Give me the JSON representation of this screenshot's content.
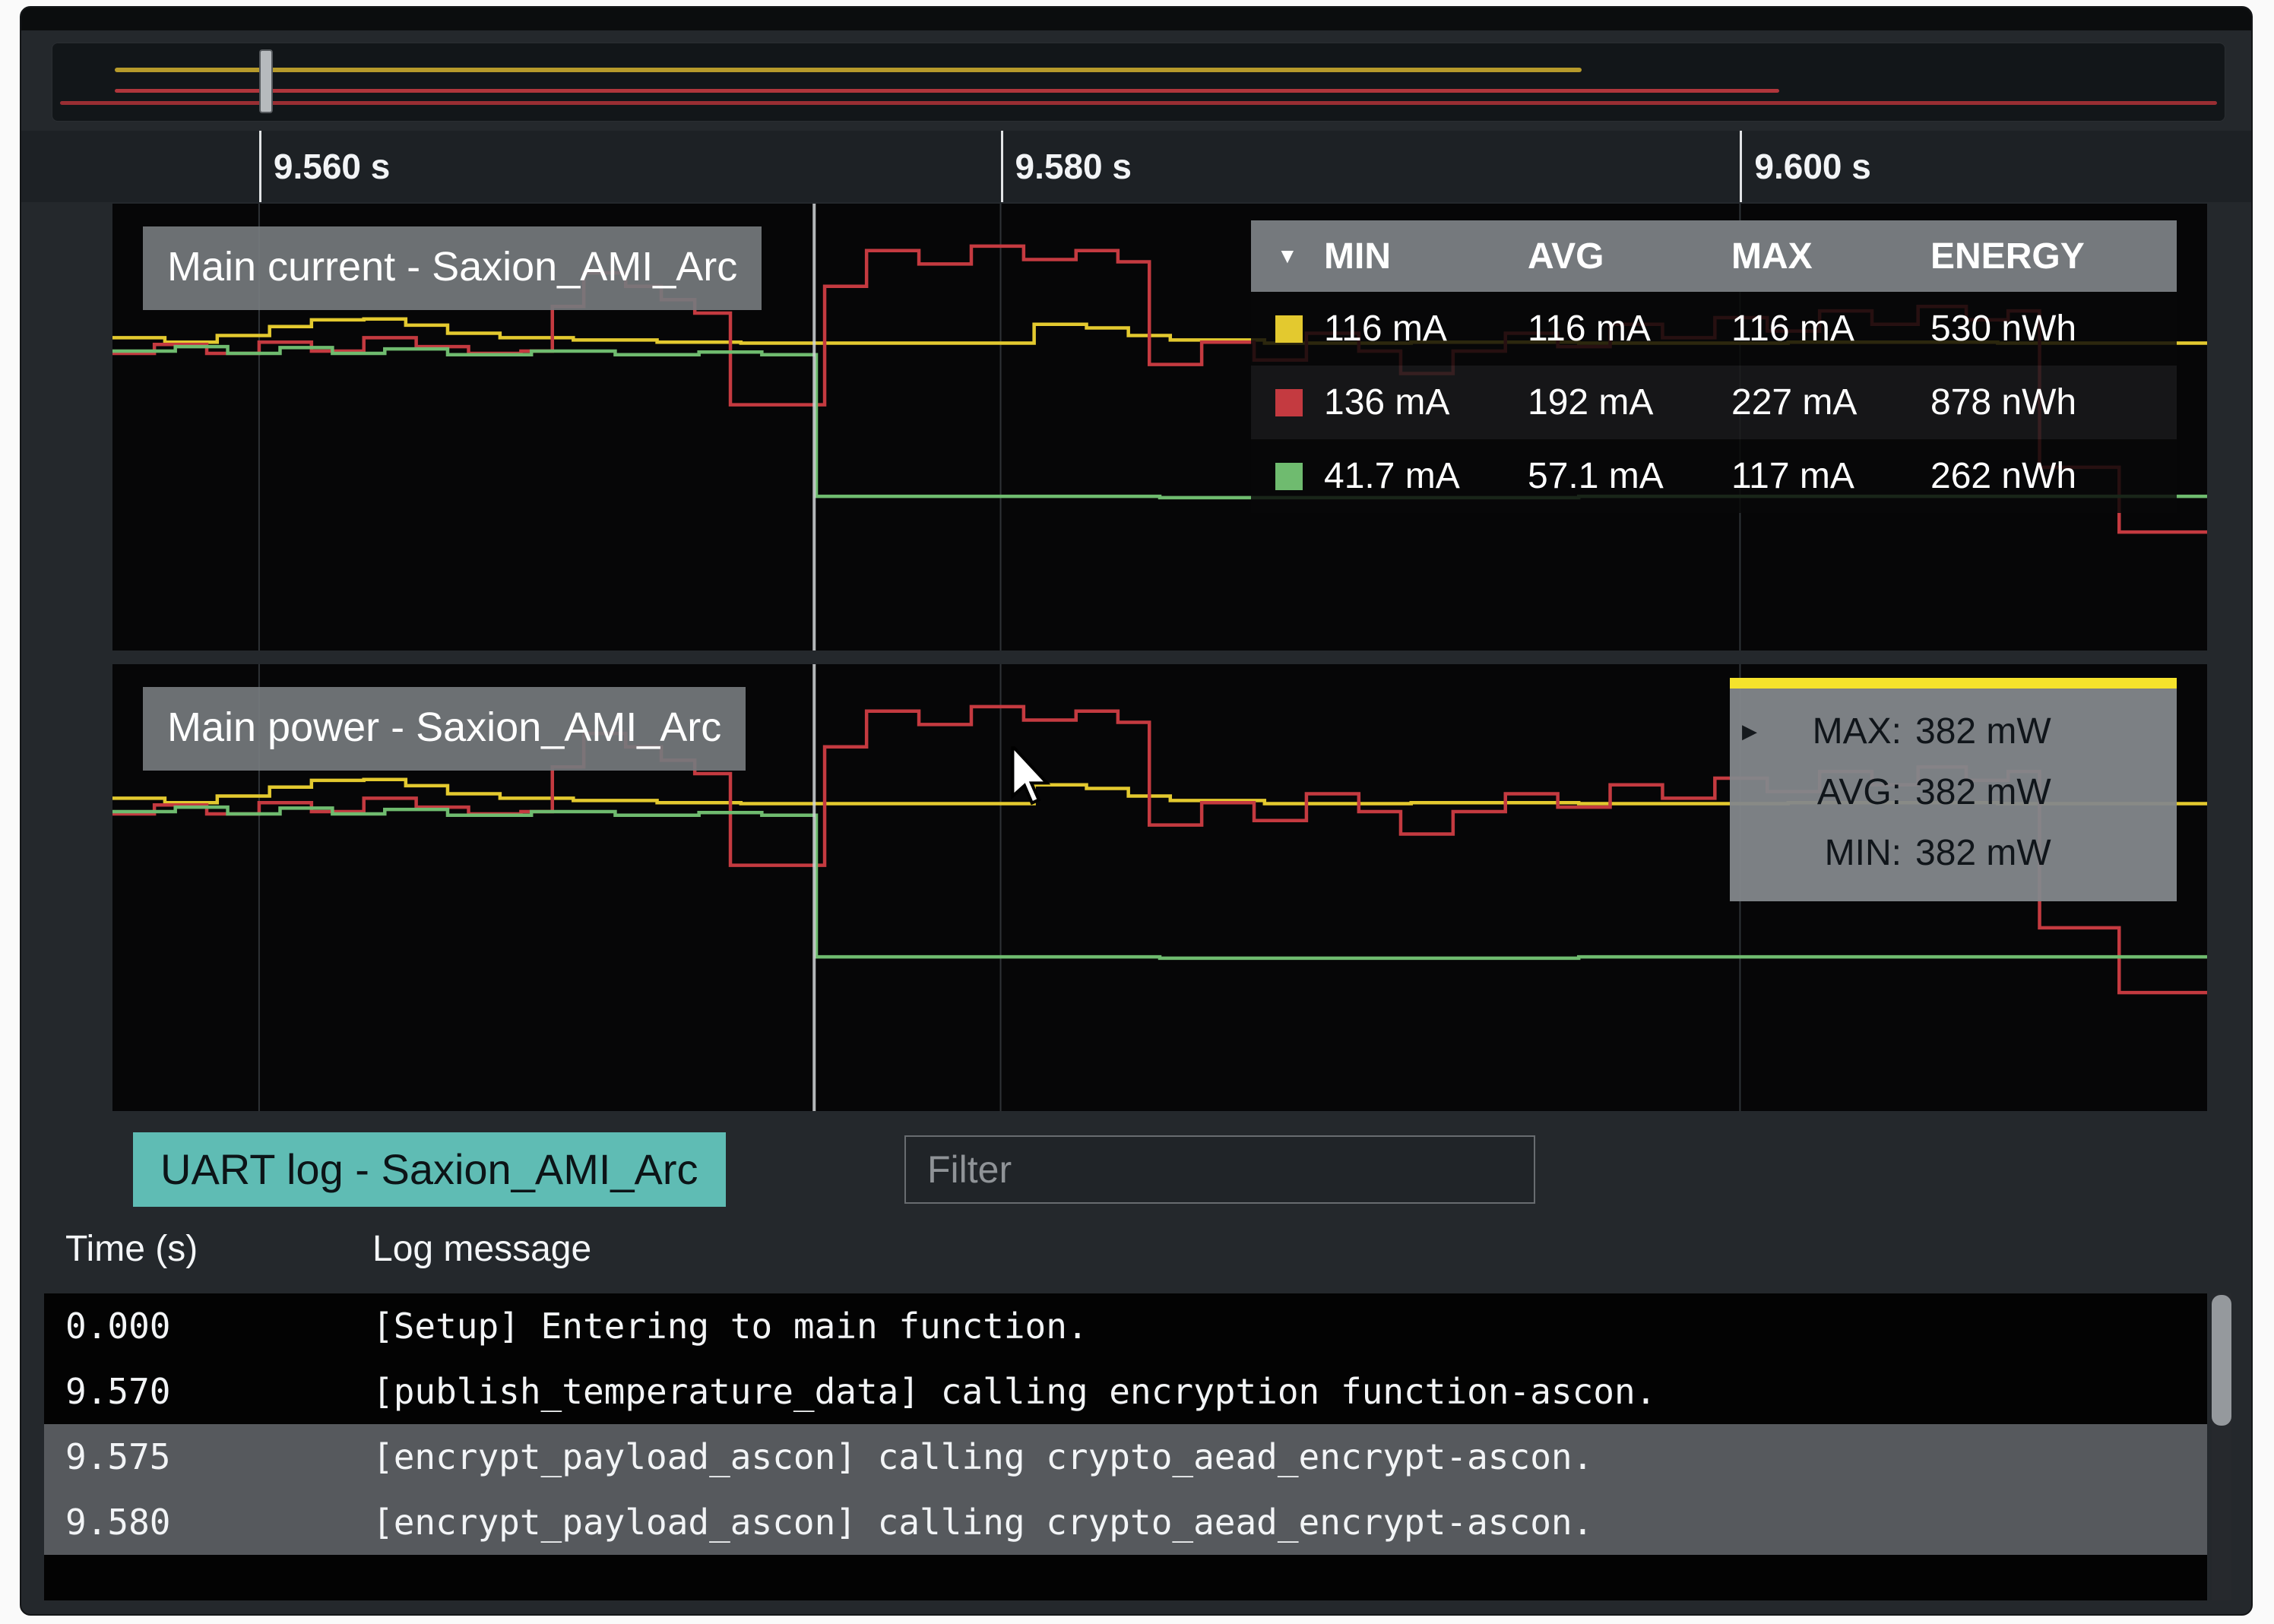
{
  "colors": {
    "yellow": "#e3c92f",
    "red": "#c43a40",
    "green": "#6fbb6f",
    "overview_yellow": "#c9a92e",
    "overview_red": "#c23a40",
    "overview_red_dark": "#b23238",
    "tooltip_accent": "#f5e32c",
    "uart_chip": "#5fbcb4"
  },
  "timeline": {
    "cursor_frac": 0.335,
    "ticks": [
      {
        "label": "9.560 s",
        "frac": 0.07
      },
      {
        "label": "9.580 s",
        "frac": 0.424
      },
      {
        "label": "9.600 s",
        "frac": 0.777
      }
    ]
  },
  "stats_table": {
    "sort_icon": "▼",
    "columns": [
      "MIN",
      "AVG",
      "MAX",
      "ENERGY"
    ],
    "rows": [
      {
        "color": "#e3c92f",
        "min": "116 mA",
        "avg": "116 mA",
        "max": "116 mA",
        "energy": "530 nWh"
      },
      {
        "color": "#c43a40",
        "min": "136 mA",
        "avg": "192 mA",
        "max": "227 mA",
        "energy": "878 nWh"
      },
      {
        "color": "#6fbb6f",
        "min": "41.7 mA",
        "avg": "57.1 mA",
        "max": "117 mA",
        "energy": "262 nWh"
      }
    ]
  },
  "power_tooltip": {
    "marker": "▶",
    "accent": "#f5e32c",
    "rows": [
      {
        "label": "MAX:",
        "value": "382 mW"
      },
      {
        "label": "AVG:",
        "value": "382 mW"
      },
      {
        "label": "MIN:",
        "value": "382 mW"
      }
    ]
  },
  "uart": {
    "title": "UART log - Saxion_AMI_Arc",
    "chip_color": "#5fbcb4",
    "filter_placeholder": "Filter",
    "columns": {
      "time": "Time (s)",
      "message": "Log message"
    },
    "rows": [
      {
        "time": "0.000",
        "message": "[Setup] Entering to main function."
      },
      {
        "time": "9.570",
        "message": "[publish_temperature_data] calling encryption function-ascon."
      },
      {
        "time": "9.575",
        "message": "[encrypt_payload_ascon] calling crypto_aead_encrypt-ascon."
      },
      {
        "time": "9.580",
        "message": "[encrypt_payload_ascon] calling crypto_aead_encrypt-ascon."
      }
    ]
  },
  "chart_data": [
    {
      "type": "line",
      "title": "Main current - Saxion_AMI_Arc",
      "x_ticks": [
        "9.560 s",
        "9.580 s",
        "9.600 s"
      ],
      "y_axis": "unlabeled (current in mA; stats shown in overlay table)",
      "series": [
        {
          "name": "channel-yellow",
          "color": "#e3c92f",
          "stats": {
            "min": "116 mA",
            "avg": "116 mA",
            "max": "116 mA",
            "energy": "530 nWh"
          },
          "points": [
            [
              0.0,
              0.3
            ],
            [
              0.025,
              0.31
            ],
            [
              0.05,
              0.295
            ],
            [
              0.075,
              0.275
            ],
            [
              0.095,
              0.26
            ],
            [
              0.12,
              0.258
            ],
            [
              0.14,
              0.272
            ],
            [
              0.16,
              0.29
            ],
            [
              0.185,
              0.3
            ],
            [
              0.22,
              0.305
            ],
            [
              0.26,
              0.31
            ],
            [
              0.3,
              0.312
            ],
            [
              0.335,
              0.312
            ],
            [
              0.38,
              0.312
            ],
            [
              0.425,
              0.312
            ],
            [
              0.44,
              0.27
            ],
            [
              0.465,
              0.278
            ],
            [
              0.485,
              0.295
            ],
            [
              0.505,
              0.305
            ],
            [
              0.55,
              0.312
            ],
            [
              0.62,
              0.31
            ],
            [
              0.7,
              0.312
            ],
            [
              0.8,
              0.31
            ],
            [
              0.9,
              0.312
            ],
            [
              1.0,
              0.312
            ]
          ]
        },
        {
          "name": "channel-red",
          "color": "#c43a40",
          "stats": {
            "min": "136 mA",
            "avg": "192 mA",
            "max": "227 mA",
            "energy": "878 nWh"
          },
          "points": [
            [
              0.0,
              0.335
            ],
            [
              0.02,
              0.315
            ],
            [
              0.045,
              0.335
            ],
            [
              0.07,
              0.31
            ],
            [
              0.095,
              0.33
            ],
            [
              0.12,
              0.3
            ],
            [
              0.145,
              0.32
            ],
            [
              0.17,
              0.335
            ],
            [
              0.195,
              0.33
            ],
            [
              0.21,
              0.23
            ],
            [
              0.225,
              0.155
            ],
            [
              0.245,
              0.185
            ],
            [
              0.262,
              0.215
            ],
            [
              0.278,
              0.245
            ],
            [
              0.295,
              0.45
            ],
            [
              0.333,
              0.45
            ],
            [
              0.34,
              0.185
            ],
            [
              0.36,
              0.105
            ],
            [
              0.385,
              0.135
            ],
            [
              0.41,
              0.095
            ],
            [
              0.435,
              0.125
            ],
            [
              0.46,
              0.105
            ],
            [
              0.48,
              0.13
            ],
            [
              0.495,
              0.36
            ],
            [
              0.52,
              0.31
            ],
            [
              0.545,
              0.35
            ],
            [
              0.57,
              0.29
            ],
            [
              0.595,
              0.33
            ],
            [
              0.615,
              0.38
            ],
            [
              0.64,
              0.33
            ],
            [
              0.665,
              0.29
            ],
            [
              0.69,
              0.32
            ],
            [
              0.715,
              0.27
            ],
            [
              0.74,
              0.3
            ],
            [
              0.765,
              0.255
            ],
            [
              0.79,
              0.285
            ],
            [
              0.815,
              0.24
            ],
            [
              0.84,
              0.27
            ],
            [
              0.862,
              0.23
            ],
            [
              0.885,
              0.26
            ],
            [
              0.905,
              0.24
            ],
            [
              0.92,
              0.59
            ],
            [
              0.955,
              0.59
            ],
            [
              0.958,
              0.735
            ],
            [
              1.0,
              0.735
            ]
          ]
        },
        {
          "name": "channel-green",
          "color": "#6fbb6f",
          "stats": {
            "min": "41.7 mA",
            "avg": "57.1 mA",
            "max": "117 mA",
            "energy": "262 nWh"
          },
          "points": [
            [
              0.0,
              0.33
            ],
            [
              0.03,
              0.32
            ],
            [
              0.055,
              0.335
            ],
            [
              0.08,
              0.322
            ],
            [
              0.105,
              0.335
            ],
            [
              0.13,
              0.325
            ],
            [
              0.16,
              0.338
            ],
            [
              0.2,
              0.33
            ],
            [
              0.24,
              0.338
            ],
            [
              0.28,
              0.332
            ],
            [
              0.31,
              0.338
            ],
            [
              0.333,
              0.338
            ],
            [
              0.336,
              0.655
            ],
            [
              0.5,
              0.658
            ],
            [
              0.7,
              0.655
            ],
            [
              1.0,
              0.658
            ]
          ]
        }
      ]
    },
    {
      "type": "line",
      "title": "Main power - Saxion_AMI_Arc",
      "x_ticks": [
        "9.560 s",
        "9.580 s",
        "9.600 s"
      ],
      "y_axis": "unlabeled (power in mW; tooltip shows MAX/AVG/MIN 382 mW)",
      "series": [
        {
          "name": "channel-yellow",
          "color": "#e3c92f",
          "stats": {
            "min": "382 mW",
            "avg": "382 mW",
            "max": "382 mW"
          },
          "points": [
            [
              0.0,
              0.3
            ],
            [
              0.025,
              0.31
            ],
            [
              0.05,
              0.295
            ],
            [
              0.075,
              0.275
            ],
            [
              0.095,
              0.26
            ],
            [
              0.12,
              0.258
            ],
            [
              0.14,
              0.272
            ],
            [
              0.16,
              0.29
            ],
            [
              0.185,
              0.3
            ],
            [
              0.22,
              0.305
            ],
            [
              0.26,
              0.31
            ],
            [
              0.3,
              0.312
            ],
            [
              0.335,
              0.312
            ],
            [
              0.38,
              0.312
            ],
            [
              0.425,
              0.312
            ],
            [
              0.44,
              0.27
            ],
            [
              0.465,
              0.278
            ],
            [
              0.485,
              0.295
            ],
            [
              0.505,
              0.305
            ],
            [
              0.55,
              0.312
            ],
            [
              0.62,
              0.31
            ],
            [
              0.7,
              0.312
            ],
            [
              0.8,
              0.31
            ],
            [
              0.9,
              0.312
            ],
            [
              1.0,
              0.312
            ]
          ]
        },
        {
          "name": "channel-red",
          "color": "#c43a40",
          "points": [
            [
              0.0,
              0.335
            ],
            [
              0.02,
              0.315
            ],
            [
              0.045,
              0.335
            ],
            [
              0.07,
              0.31
            ],
            [
              0.095,
              0.33
            ],
            [
              0.12,
              0.3
            ],
            [
              0.145,
              0.32
            ],
            [
              0.17,
              0.335
            ],
            [
              0.195,
              0.33
            ],
            [
              0.21,
              0.23
            ],
            [
              0.225,
              0.155
            ],
            [
              0.245,
              0.185
            ],
            [
              0.262,
              0.215
            ],
            [
              0.278,
              0.245
            ],
            [
              0.295,
              0.45
            ],
            [
              0.333,
              0.45
            ],
            [
              0.34,
              0.185
            ],
            [
              0.36,
              0.105
            ],
            [
              0.385,
              0.135
            ],
            [
              0.41,
              0.095
            ],
            [
              0.435,
              0.125
            ],
            [
              0.46,
              0.105
            ],
            [
              0.48,
              0.13
            ],
            [
              0.495,
              0.36
            ],
            [
              0.52,
              0.31
            ],
            [
              0.545,
              0.35
            ],
            [
              0.57,
              0.29
            ],
            [
              0.595,
              0.33
            ],
            [
              0.615,
              0.38
            ],
            [
              0.64,
              0.33
            ],
            [
              0.665,
              0.29
            ],
            [
              0.69,
              0.32
            ],
            [
              0.715,
              0.27
            ],
            [
              0.74,
              0.3
            ],
            [
              0.765,
              0.255
            ],
            [
              0.79,
              0.285
            ],
            [
              0.815,
              0.24
            ],
            [
              0.84,
              0.27
            ],
            [
              0.862,
              0.23
            ],
            [
              0.885,
              0.26
            ],
            [
              0.905,
              0.24
            ],
            [
              0.92,
              0.59
            ],
            [
              0.955,
              0.59
            ],
            [
              0.958,
              0.735
            ],
            [
              1.0,
              0.735
            ]
          ]
        },
        {
          "name": "channel-green",
          "color": "#6fbb6f",
          "points": [
            [
              0.0,
              0.33
            ],
            [
              0.03,
              0.32
            ],
            [
              0.055,
              0.335
            ],
            [
              0.08,
              0.322
            ],
            [
              0.105,
              0.335
            ],
            [
              0.13,
              0.325
            ],
            [
              0.16,
              0.338
            ],
            [
              0.2,
              0.33
            ],
            [
              0.24,
              0.338
            ],
            [
              0.28,
              0.332
            ],
            [
              0.31,
              0.338
            ],
            [
              0.333,
              0.338
            ],
            [
              0.336,
              0.655
            ],
            [
              0.5,
              0.658
            ],
            [
              0.7,
              0.655
            ],
            [
              1.0,
              0.658
            ]
          ]
        }
      ]
    }
  ]
}
